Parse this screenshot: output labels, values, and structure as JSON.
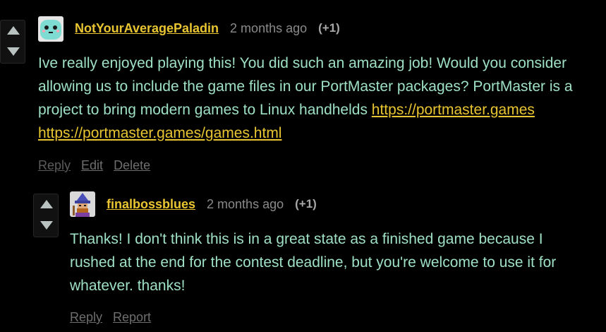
{
  "comments": [
    {
      "username": "NotYourAveragePaladin",
      "timestamp": "2 months ago",
      "score": "(+1)",
      "body_text": "Ive really enjoyed playing this! You did such an amazing job! Would you consider allowing us to include the game files in our PortMaster packages? PortMaster is a project to bring modern games to Linux handhelds",
      "link_1": "https://portmaster.games",
      "link_2": "https://portmaster.games/games.html",
      "actions": {
        "reply": "Reply",
        "edit": "Edit",
        "delete": "Delete"
      },
      "icons": {
        "upvote": "triangle-up-icon",
        "downvote": "triangle-down-icon",
        "avatar": "ghost-avatar"
      }
    },
    {
      "username": "finalbossblues",
      "timestamp": "2 months ago",
      "score": "(+1)",
      "body_text": "Thanks! I don't think this is in a great state as a finished game because I rushed at the end for the contest deadline, but you're welcome to use it for whatever. thanks!",
      "actions": {
        "reply": "Reply",
        "report": "Report"
      },
      "icons": {
        "upvote": "triangle-up-icon",
        "downvote": "triangle-down-icon",
        "avatar": "wizard-pixel-avatar"
      }
    }
  ],
  "colors": {
    "background": "#000000",
    "username": "#e8c531",
    "body_text": "#9ee0c4",
    "link": "#e8c531",
    "timestamp": "#8a8a8a",
    "action": "#6e6e6e"
  }
}
